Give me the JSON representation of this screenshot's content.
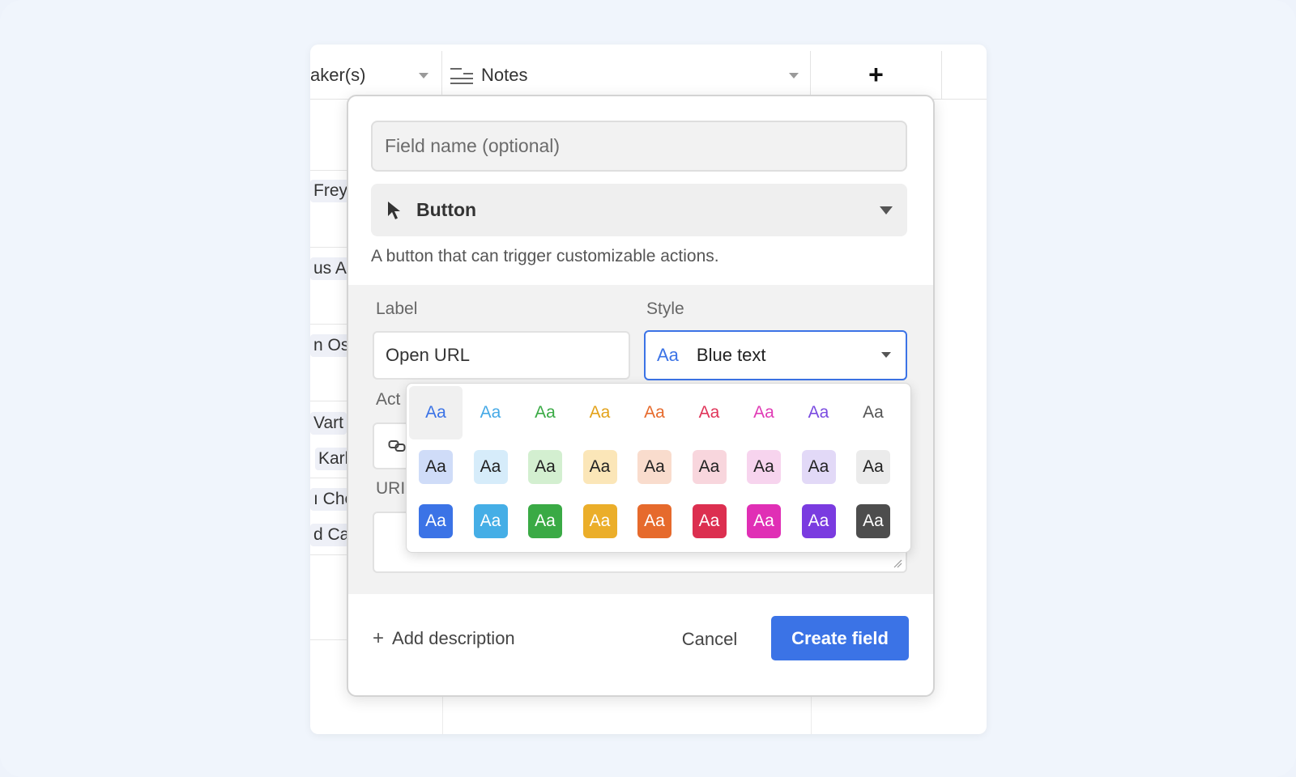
{
  "grid": {
    "columns": [
      {
        "label": "aker(s)"
      },
      {
        "label": "Notes"
      },
      {
        "label": "+"
      }
    ],
    "row_fragments": [
      "Frey",
      "us A",
      "n Os",
      "Vart",
      "Karl",
      "ı Che",
      "d Ca"
    ]
  },
  "modal": {
    "field_name_placeholder": "Field name (optional)",
    "type_label": "Button",
    "type_description": "A button that can trigger customizable actions.",
    "label_title": "Label",
    "label_value": "Open URL",
    "style_title": "Style",
    "style_value": "Blue text",
    "style_preview": "Aa",
    "action_title": "Act",
    "url_title": "URI",
    "add_description": "Add description",
    "cancel": "Cancel",
    "create": "Create field"
  },
  "palette": {
    "sample_text": "Aa",
    "selected": "Blue text",
    "text_colors": [
      "#3b73e6",
      "#45a9e6",
      "#3aaa45",
      "#e3a21a",
      "#e66a2c",
      "#e0355a",
      "#e03bb5",
      "#7a4be0",
      "#555555"
    ],
    "light_bg_colors": [
      "#cfdcf8",
      "#d6ecfa",
      "#d3efd0",
      "#fbe6b8",
      "#f9dccd",
      "#f8d6dd",
      "#f7d4ee",
      "#e2d9f7",
      "#ebebeb"
    ],
    "solid_bg_colors": [
      "#3b73e6",
      "#45aee6",
      "#3aaa45",
      "#ebae2a",
      "#e66a2c",
      "#dc2f50",
      "#e02fb5",
      "#7a3be0",
      "#4d4d4d"
    ]
  }
}
